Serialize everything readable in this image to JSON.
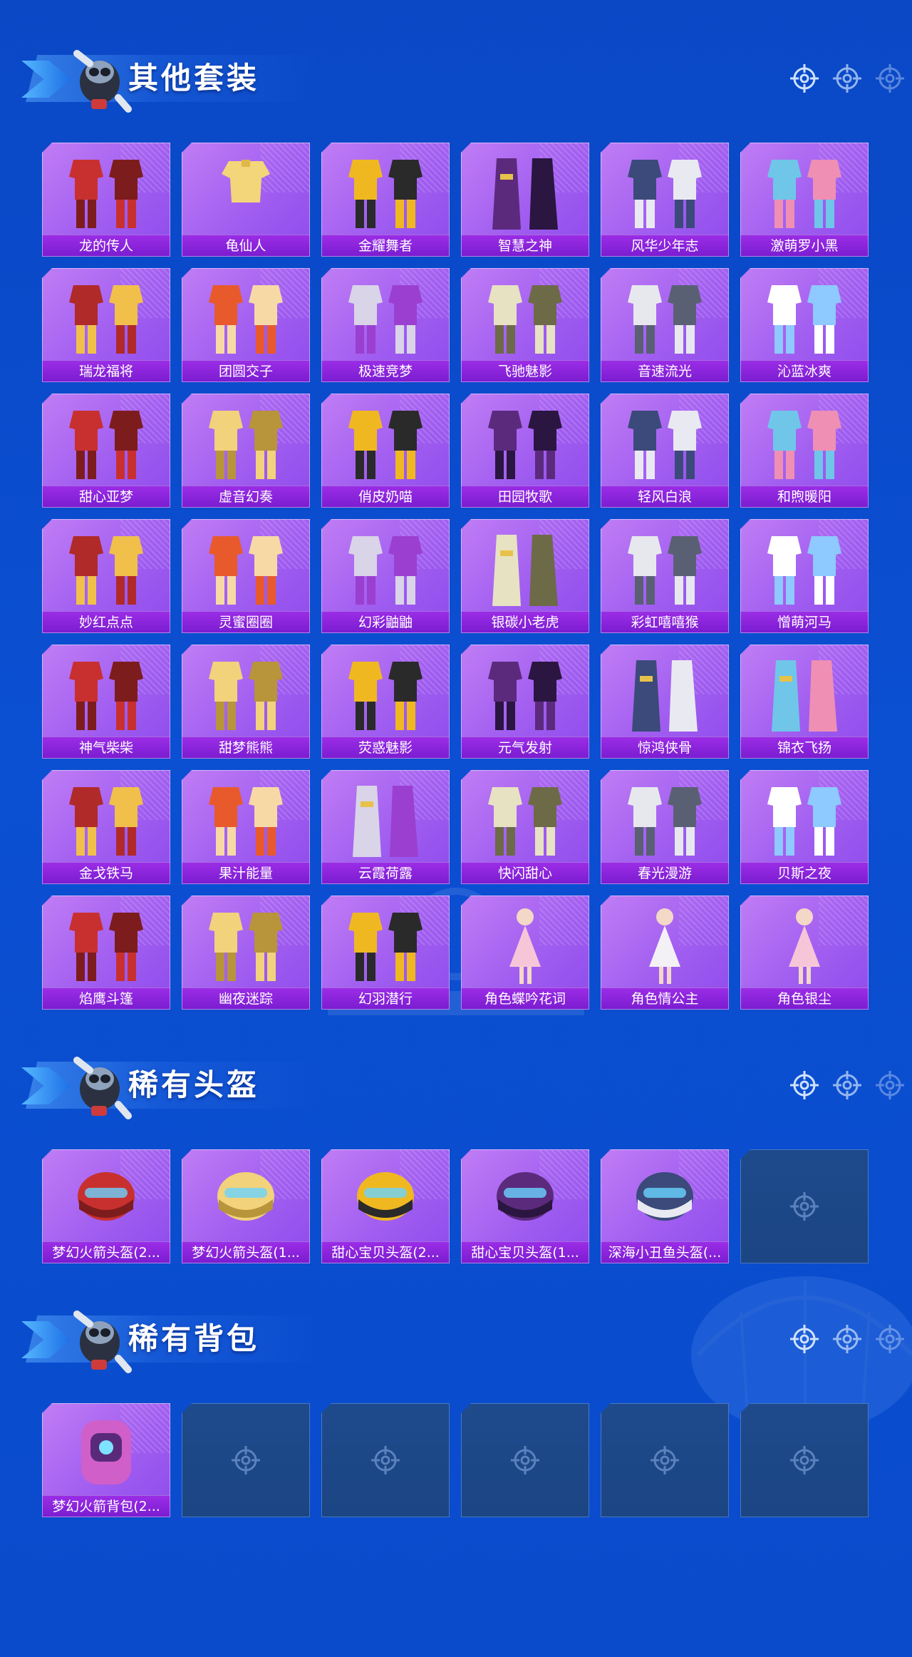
{
  "colors": {
    "background": "#0b4fd2",
    "card_purple": "#a15ef0",
    "label_bar": "#8a24dc",
    "empty_slot": "#1e4a8c",
    "title_text": "#ffffff"
  },
  "sections": [
    {
      "id": "outfits",
      "title": "其他套装",
      "items": [
        {
          "label": "龙的传人",
          "art": "outfit"
        },
        {
          "label": "龟仙人",
          "art": "shirt"
        },
        {
          "label": "金耀舞者",
          "art": "outfit"
        },
        {
          "label": "智慧之神",
          "art": "robe"
        },
        {
          "label": "风华少年志",
          "art": "outfit"
        },
        {
          "label": "激萌罗小黑",
          "art": "outfit"
        },
        {
          "label": "瑞龙福将",
          "art": "outfit"
        },
        {
          "label": "团圆交子",
          "art": "outfit"
        },
        {
          "label": "极速竞梦",
          "art": "outfit"
        },
        {
          "label": "飞驰魅影",
          "art": "outfit"
        },
        {
          "label": "音速流光",
          "art": "outfit"
        },
        {
          "label": "沁蓝冰爽",
          "art": "outfit"
        },
        {
          "label": "甜心亚梦",
          "art": "outfit"
        },
        {
          "label": "虚音幻奏",
          "art": "outfit"
        },
        {
          "label": "俏皮奶喵",
          "art": "outfit"
        },
        {
          "label": "田园牧歌",
          "art": "outfit"
        },
        {
          "label": "轻风白浪",
          "art": "outfit"
        },
        {
          "label": "和煦暖阳",
          "art": "outfit"
        },
        {
          "label": "妙红点点",
          "art": "outfit"
        },
        {
          "label": "灵蜜圈圈",
          "art": "outfit"
        },
        {
          "label": "幻彩鼬鼬",
          "art": "outfit"
        },
        {
          "label": "银碳小老虎",
          "art": "robe"
        },
        {
          "label": "彩虹嘻嘻猴",
          "art": "outfit"
        },
        {
          "label": "憎萌河马",
          "art": "outfit"
        },
        {
          "label": "神气柴柴",
          "art": "outfit"
        },
        {
          "label": "甜梦熊熊",
          "art": "outfit"
        },
        {
          "label": "荧惑魅影",
          "art": "outfit"
        },
        {
          "label": "元气发射",
          "art": "outfit"
        },
        {
          "label": "惊鸿侠骨",
          "art": "robe"
        },
        {
          "label": "锦衣飞扬",
          "art": "robe"
        },
        {
          "label": "金戈铁马",
          "art": "outfit"
        },
        {
          "label": "果汁能量",
          "art": "outfit"
        },
        {
          "label": "云霞荷露",
          "art": "robe"
        },
        {
          "label": "快闪甜心",
          "art": "outfit"
        },
        {
          "label": "春光漫游",
          "art": "outfit"
        },
        {
          "label": "贝斯之夜",
          "art": "outfit"
        },
        {
          "label": "焰鹰斗篷",
          "art": "outfit"
        },
        {
          "label": "幽夜迷踪",
          "art": "outfit"
        },
        {
          "label": "幻羽潜行",
          "art": "outfit"
        },
        {
          "label": "角色蝶吟花词",
          "art": "character"
        },
        {
          "label": "角色情公主",
          "art": "character"
        },
        {
          "label": "角色银尘",
          "art": "character"
        }
      ]
    },
    {
      "id": "helmets",
      "title": "稀有头盔",
      "items": [
        {
          "label": "梦幻火箭头盔(2...",
          "art": "helmet"
        },
        {
          "label": "梦幻火箭头盔(1...",
          "art": "helmet"
        },
        {
          "label": "甜心宝贝头盔(2...",
          "art": "helmet"
        },
        {
          "label": "甜心宝贝头盔(1...",
          "art": "helmet"
        },
        {
          "label": "深海小丑鱼头盔(...",
          "art": "helmet"
        }
      ],
      "empty_slots": 1
    },
    {
      "id": "backpacks",
      "title": "稀有背包",
      "items": [
        {
          "label": "梦幻火箭背包(2...",
          "art": "backpack"
        }
      ],
      "empty_slots": 5
    }
  ]
}
